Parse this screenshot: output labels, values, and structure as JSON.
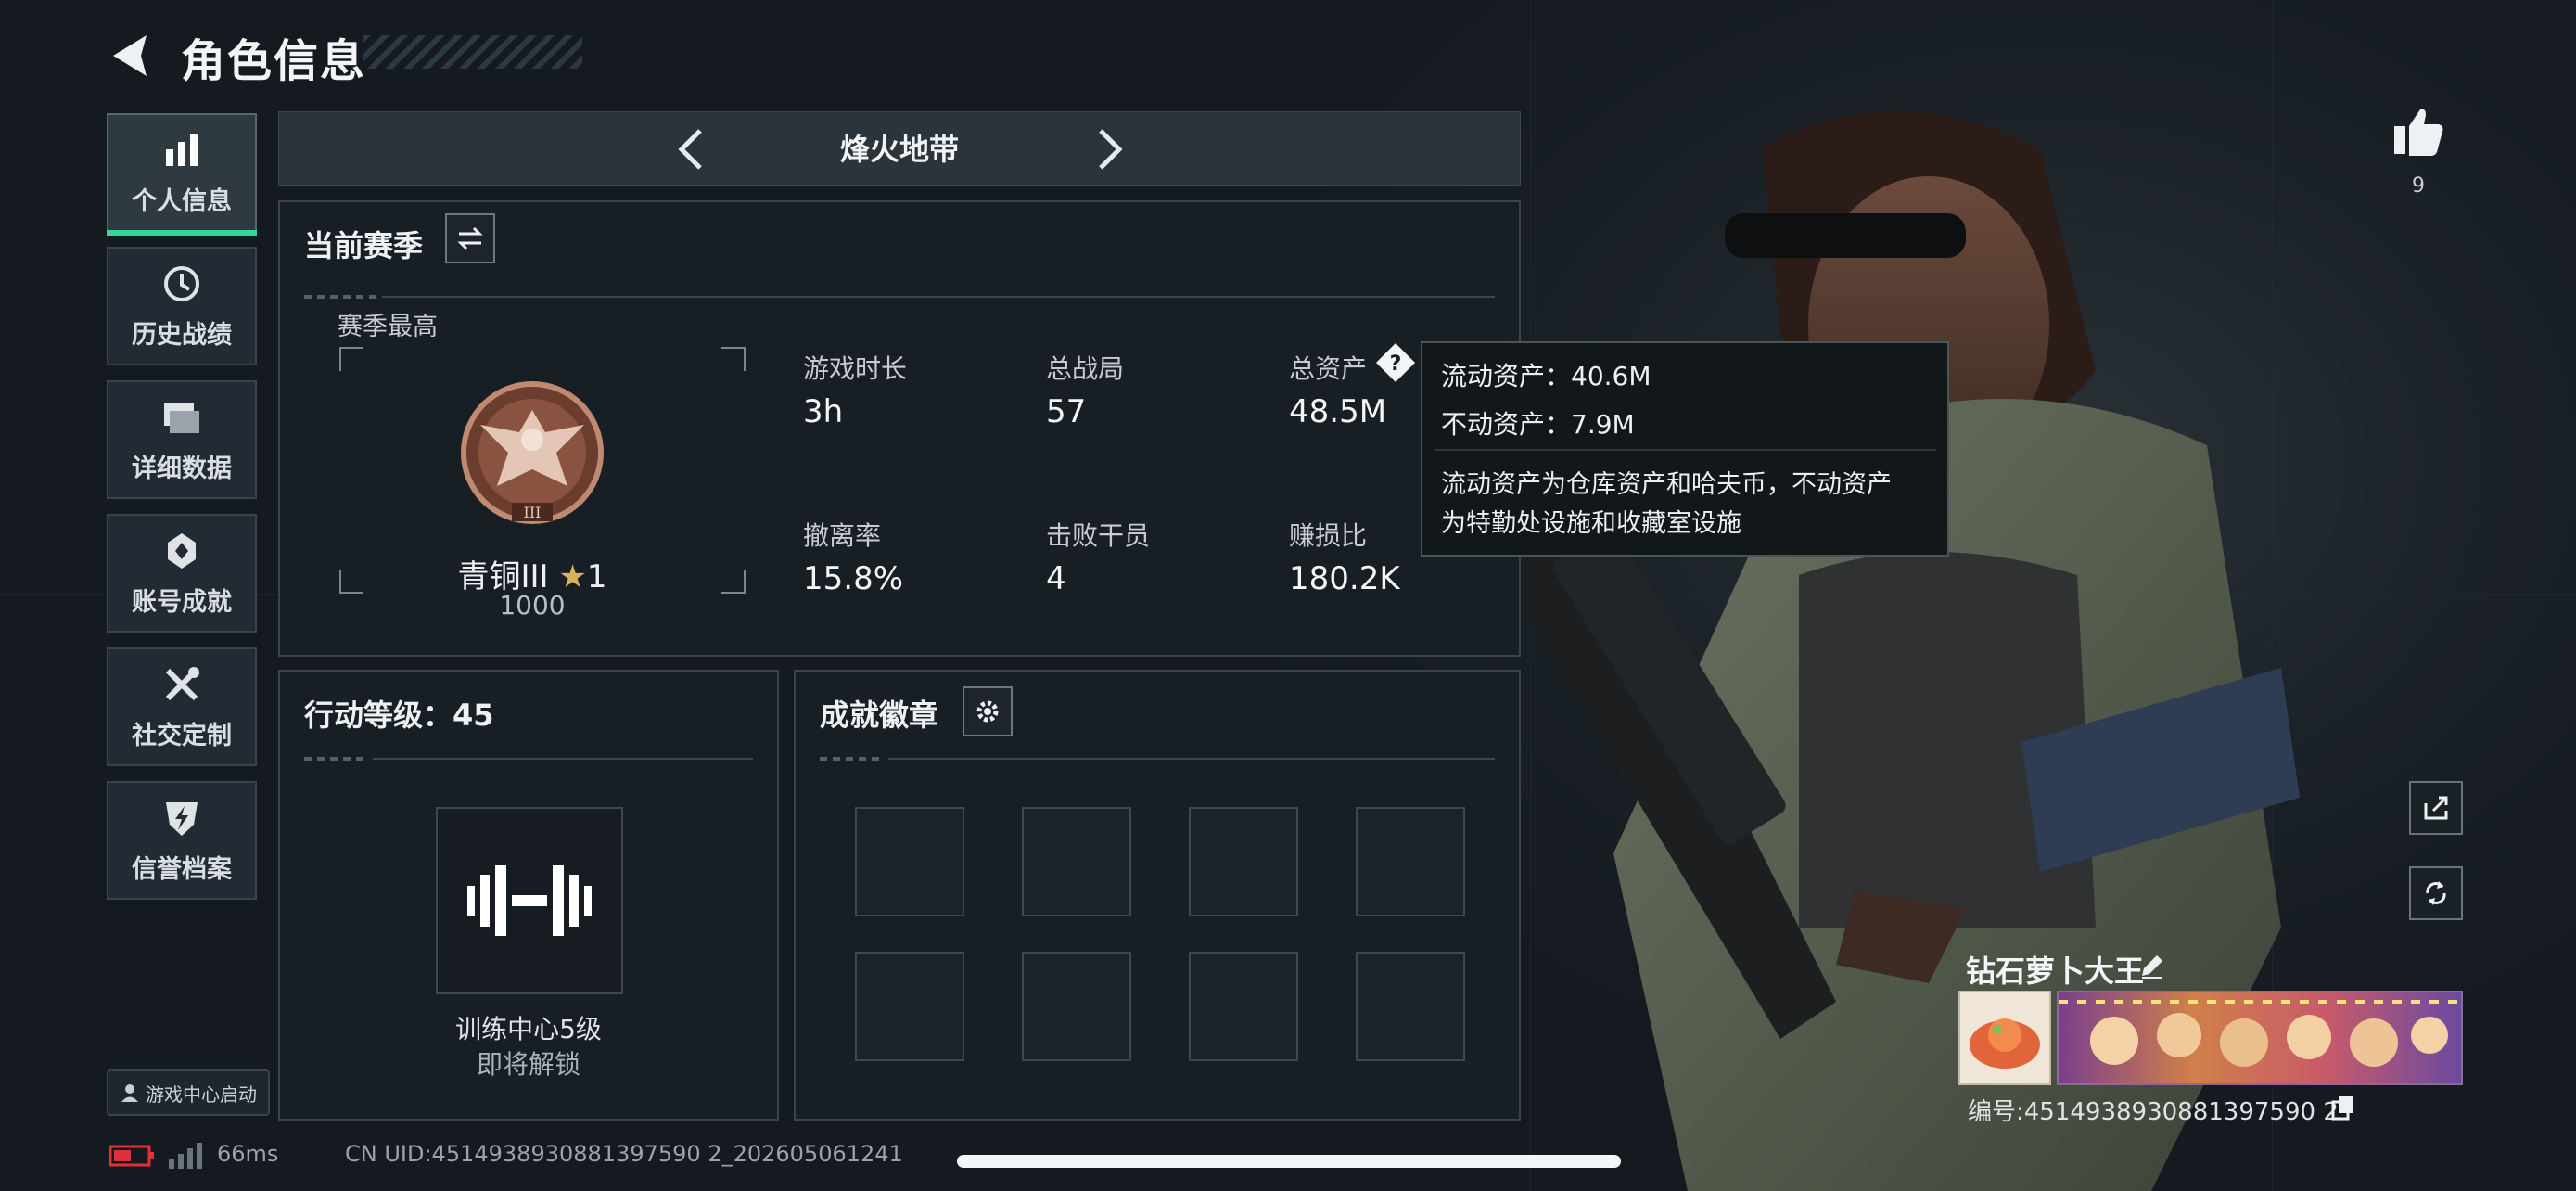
{
  "header": {
    "title": "角色信息"
  },
  "sidebar": {
    "items": [
      {
        "label": "个人信息",
        "icon": "bar-chart-icon",
        "active": true
      },
      {
        "label": "历史战绩",
        "icon": "history-clock-icon"
      },
      {
        "label": "详细数据",
        "icon": "folder-icon"
      },
      {
        "label": "账号成就",
        "icon": "medal-icon"
      },
      {
        "label": "社交定制",
        "icon": "tools-icon"
      },
      {
        "label": "信誉档案",
        "icon": "shield-bolt-icon"
      }
    ],
    "game_center": "游戏中心启动"
  },
  "mode": {
    "label": "烽火地带"
  },
  "season": {
    "title": "当前赛季",
    "best_label": "赛季最高",
    "rank_name": "青铜III",
    "rank_stars": "1",
    "rank_points": "1000",
    "stats": [
      {
        "label": "游戏时长",
        "value": "3h"
      },
      {
        "label": "总战局",
        "value": "57"
      },
      {
        "label": "总资产",
        "value": "48.5M"
      },
      {
        "label": "撤离率",
        "value": "15.8%"
      },
      {
        "label": "击败干员",
        "value": "4"
      },
      {
        "label": "赚损比",
        "value": "180.2K"
      }
    ]
  },
  "tooltip": {
    "liquid": "流动资产：40.6M",
    "fixed": "不动资产：7.9M",
    "desc1": "流动资产为仓库资产和哈夫币，不动资产",
    "desc2": "为特勤处设施和收藏室设施"
  },
  "action_level": {
    "title": "行动等级：45",
    "unlock_title": "训练中心5级",
    "unlock_sub": "即将解锁"
  },
  "badges": {
    "title": "成就徽章",
    "slots": 8
  },
  "profile": {
    "likes": "9",
    "name": "钻石萝卜大王",
    "uid": "编号:4514938930881397590 2"
  },
  "footer": {
    "latency": "66ms",
    "cn_uid": "CN UID:4514938930881397590 2_202605061241"
  },
  "colors": {
    "accent": "#33d69b",
    "battery": "#e0303a",
    "panel": "#181f25"
  }
}
